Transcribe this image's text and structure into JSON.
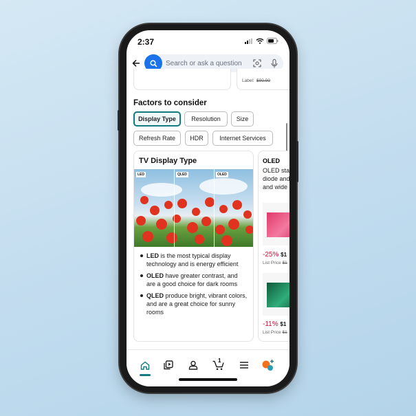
{
  "status_bar": {
    "time": "2:37"
  },
  "search": {
    "placeholder": "Search or ask a question"
  },
  "top_cards": {
    "right_label": "Label:",
    "right_price": "$00.00"
  },
  "factors": {
    "title": "Factors to consider",
    "chips": [
      {
        "label": "Display Type",
        "selected": true
      },
      {
        "label": "Resolution"
      },
      {
        "label": "Size"
      },
      {
        "label": "Refresh Rate"
      },
      {
        "label": "HDR"
      },
      {
        "label": "Internet Services"
      }
    ]
  },
  "display_card": {
    "title": "TV Display Type",
    "image_tags": [
      "LED",
      "QLED",
      "OLED"
    ],
    "bullets": [
      {
        "bold": "LED",
        "text": " is the most typical display technology and is energy efficient"
      },
      {
        "bold": "OLED",
        "text": " have greater contrast, and are a good choice for dark rooms"
      },
      {
        "bold": "QLED",
        "text": " produce bright, vibrant colors, and are a great choice for sunny rooms"
      }
    ]
  },
  "oled_card": {
    "title": "OLED",
    "desc_lines": [
      "OLED sta",
      "diode and",
      "and wide"
    ],
    "products": [
      {
        "discount": "-25%",
        "price": "$1",
        "list_label": "List Price",
        "list_price": "$1"
      },
      {
        "discount": "-11%",
        "price": "$1",
        "list_label": "List Price",
        "list_price": "$1"
      }
    ]
  },
  "bottom_nav": {
    "items": [
      "home-icon",
      "video-icon",
      "account-icon",
      "cart-icon",
      "menu-icon",
      "rufus-icon"
    ],
    "cart_count": "1",
    "active": "home",
    "accent": "#137a7f"
  },
  "colors": {
    "search_button": "#1a73e8",
    "discount": "#cc0c39",
    "chip_selected": "#137a7f"
  }
}
